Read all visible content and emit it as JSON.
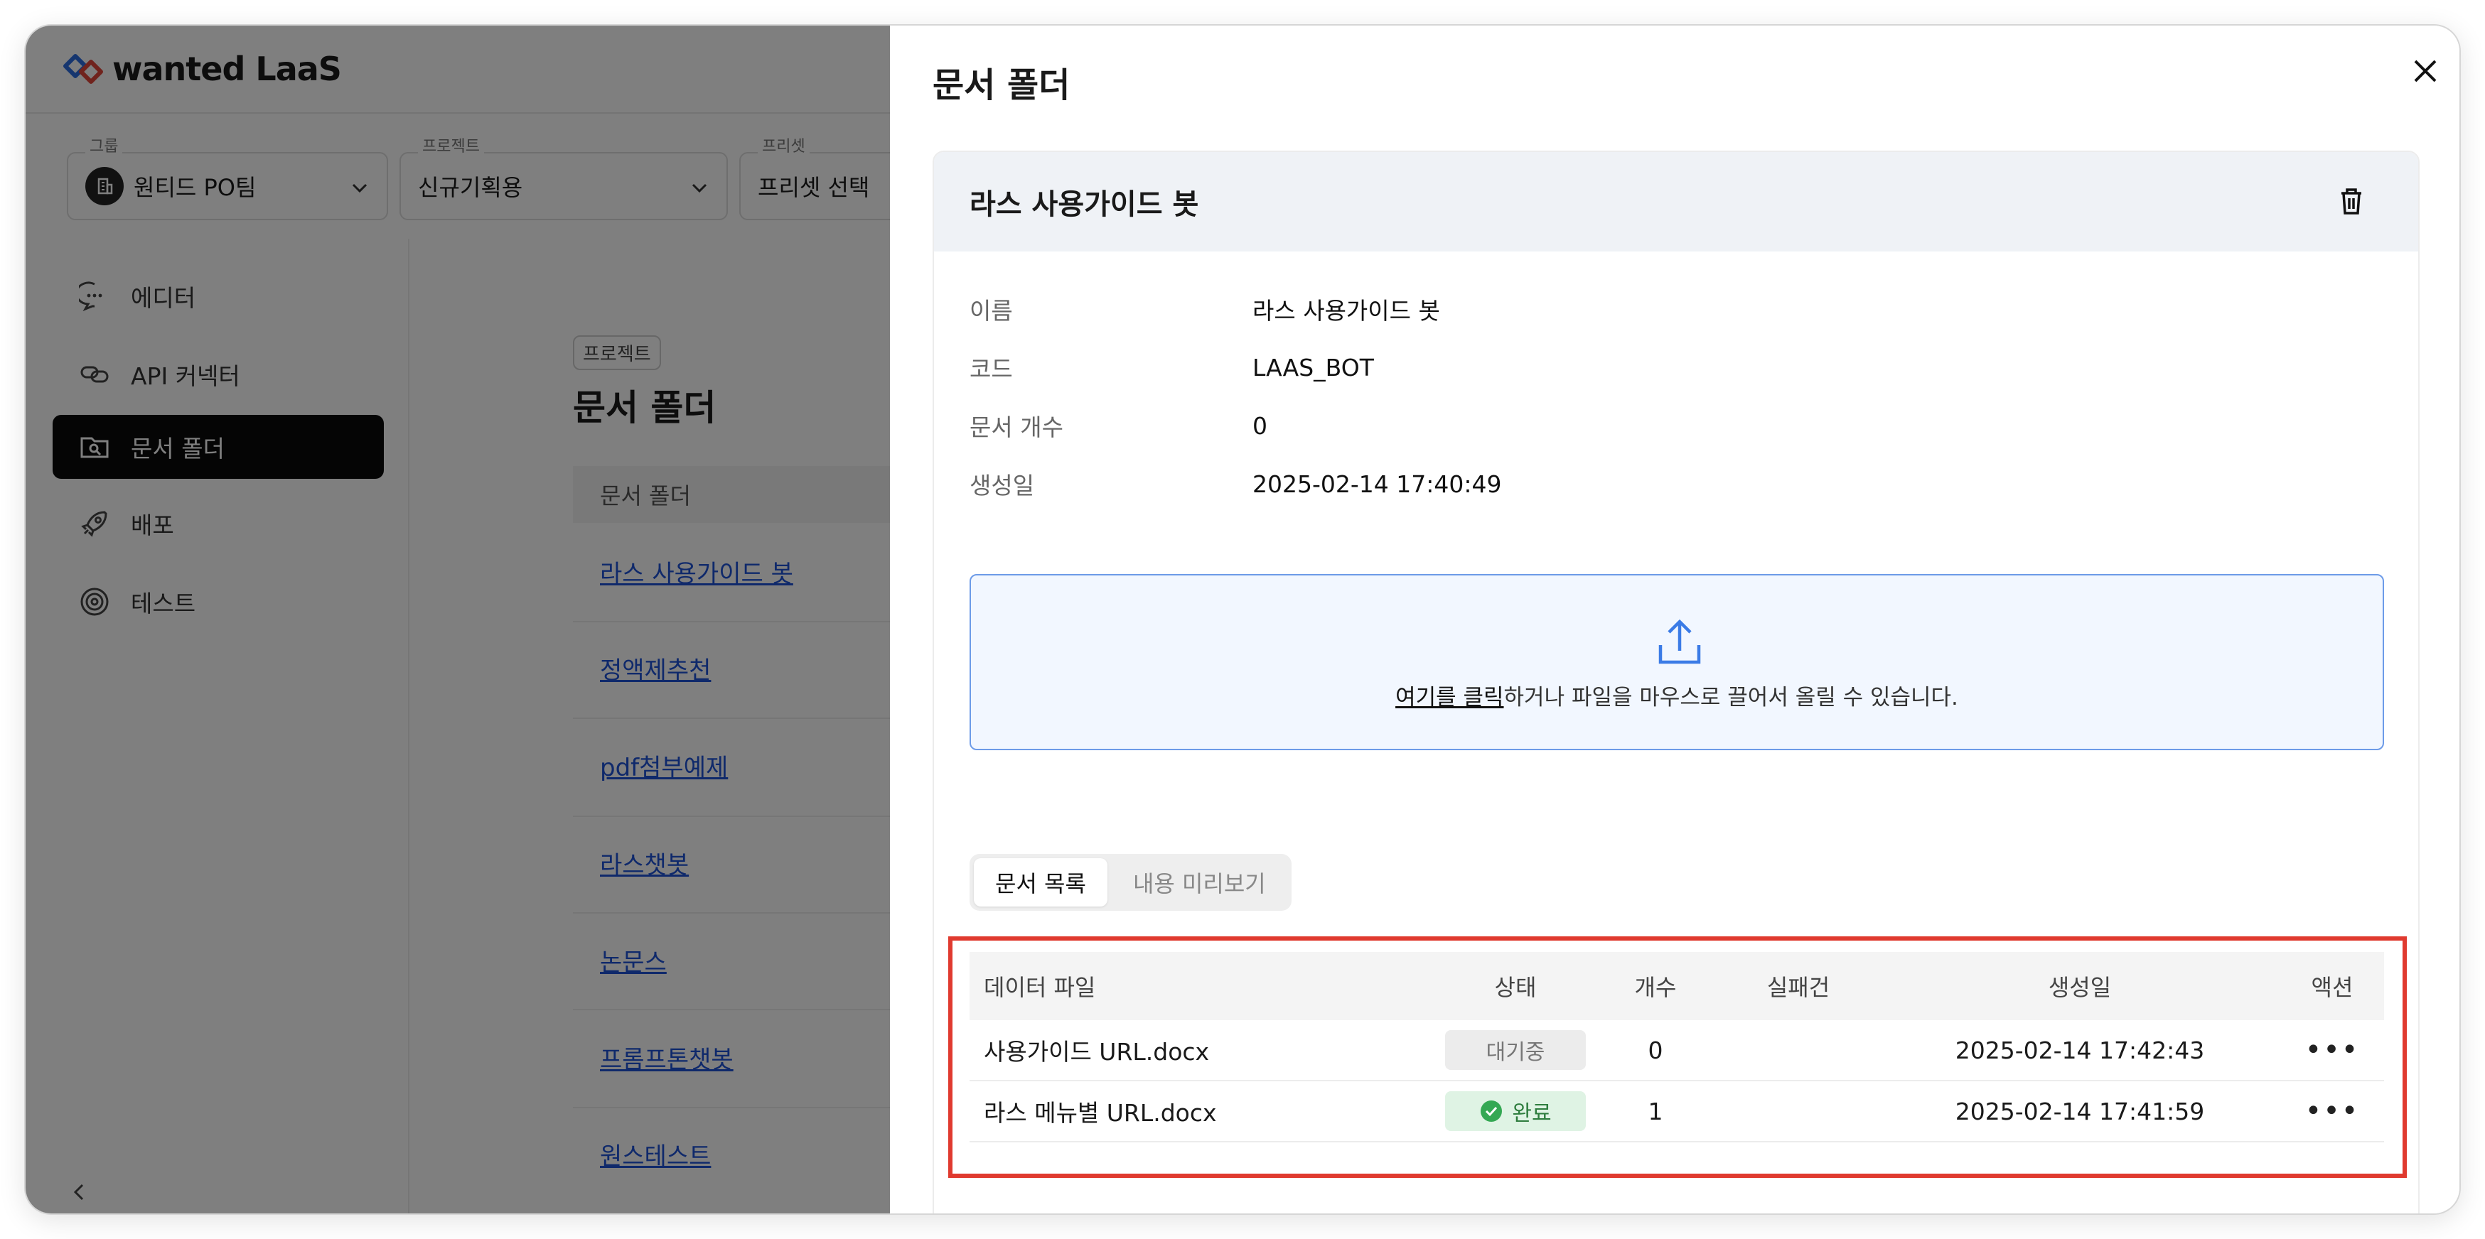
{
  "app": {
    "brand": "wanted LaaS",
    "selectors": [
      {
        "caption": "그룹",
        "value": "원티드 PO팀",
        "avatar": "🏢"
      },
      {
        "caption": "프로젝트",
        "value": "신규기획용"
      },
      {
        "caption": "프리셋",
        "value": "프리셋 선택"
      }
    ],
    "nav": [
      {
        "label": "에디터",
        "icon": "chat-bubble-icon"
      },
      {
        "label": "API 커넥터",
        "icon": "link-icon"
      },
      {
        "label": "문서 폴더",
        "icon": "folder-search-icon",
        "active": true
      },
      {
        "label": "배포",
        "icon": "rocket-icon"
      },
      {
        "label": "테스트",
        "icon": "target-icon"
      }
    ],
    "content": {
      "badge": "프로젝트",
      "title": "문서 폴더",
      "table_header": "문서 폴더",
      "folders": [
        "라스 사용가이드 봇",
        "정액제추천",
        "pdf첨부예제",
        "라스챗봇",
        "논문스",
        "프롬프톤챗봇",
        "원스테스트"
      ]
    }
  },
  "drawer": {
    "title": "문서 폴더",
    "folder_name": "라스 사용가이드 봇",
    "info": [
      {
        "key": "이름",
        "value": "라스 사용가이드 봇"
      },
      {
        "key": "코드",
        "value": "LAAS_BOT"
      },
      {
        "key": "문서 개수",
        "value": "0"
      },
      {
        "key": "생성일",
        "value": "2025-02-14 17:40:49"
      }
    ],
    "upload": {
      "link": "여기를 클릭",
      "rest": "하거나 파일을 마우스로 끌어서 올릴 수 있습니다."
    },
    "tabs": [
      "문서 목록",
      "내용 미리보기"
    ],
    "columns": [
      "데이터 파일",
      "상태",
      "개수",
      "실패건",
      "생성일",
      "액션"
    ],
    "rows": [
      {
        "file": "사용가이드 URL.docx",
        "status": "대기중",
        "status_type": "waiting",
        "count": "0",
        "failed": "",
        "created": "2025-02-14 17:42:43",
        "action": "•••"
      },
      {
        "file": "라스 메뉴별 URL.docx",
        "status": "완료",
        "status_type": "done",
        "count": "1",
        "failed": "",
        "created": "2025-02-14 17:41:59",
        "action": "•••"
      }
    ]
  },
  "colors": {
    "highlight": "#e03a2f",
    "link": "#1f53d6",
    "done_green": "#2e7d3e",
    "upload_border": "#6d9be8"
  }
}
